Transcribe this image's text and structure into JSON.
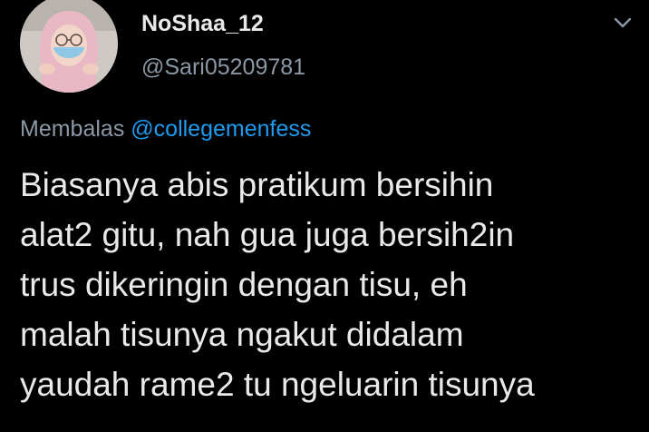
{
  "tweet": {
    "display_name": "NoShaa_12",
    "handle": "@Sari05209781",
    "reply_prefix": "Membalas",
    "reply_to": "@collegemenfess",
    "text_lines": [
      "Biasanya abis pratikum bersihin",
      "alat2 gitu, nah gua juga bersih2in",
      "trus dikeringin dengan tisu, eh",
      "malah tisunya ngakut didalam",
      "yaudah rame2 tu ngeluarin tisunya"
    ]
  },
  "icons": {
    "avatar": "profile-photo",
    "more": "chevron-down-icon"
  },
  "colors": {
    "background": "#000000",
    "primary_text": "#e7e9ea",
    "secondary_text": "#8b98a5",
    "link": "#1d9bf0"
  }
}
